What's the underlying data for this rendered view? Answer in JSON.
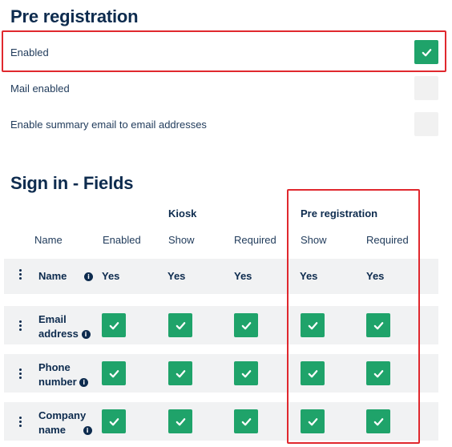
{
  "preregistration": {
    "title": "Pre registration",
    "settings": [
      {
        "label": "Enabled",
        "checked": true
      },
      {
        "label": "Mail enabled",
        "checked": false
      },
      {
        "label": "Enable summary email to email addresses",
        "checked": false
      }
    ]
  },
  "signin_fields": {
    "title": "Sign in - Fields",
    "groups": {
      "kiosk": "Kiosk",
      "prereg": "Pre registration"
    },
    "columns": {
      "name": "Name",
      "enabled": "Enabled",
      "kiosk_show": "Show",
      "kiosk_required": "Required",
      "prereg_show": "Show",
      "prereg_required": "Required"
    },
    "rows": [
      {
        "name": "Name",
        "enabled": "Yes",
        "kiosk_show": "Yes",
        "kiosk_required": "Yes",
        "prereg_show": "Yes",
        "prereg_required": "Yes"
      },
      {
        "name_line1": "Email",
        "name_line2": "address",
        "enabled": true,
        "kiosk_show": true,
        "kiosk_required": true,
        "prereg_show": true,
        "prereg_required": true
      },
      {
        "name_line1": "Phone",
        "name_line2": "number",
        "enabled": true,
        "kiosk_show": true,
        "kiosk_required": true,
        "prereg_show": true,
        "prereg_required": true
      },
      {
        "name_line1": "Company",
        "name_line2": "name",
        "enabled": true,
        "kiosk_show": true,
        "kiosk_required": true,
        "prereg_show": true,
        "prereg_required": true
      }
    ]
  },
  "icons": {
    "info": "i",
    "check": "checkmark-icon",
    "drag": "drag-handle-icon"
  },
  "colors": {
    "accent_green": "#1fa36a",
    "highlight_red": "#e0282e",
    "text_navy": "#0d2b4e"
  }
}
